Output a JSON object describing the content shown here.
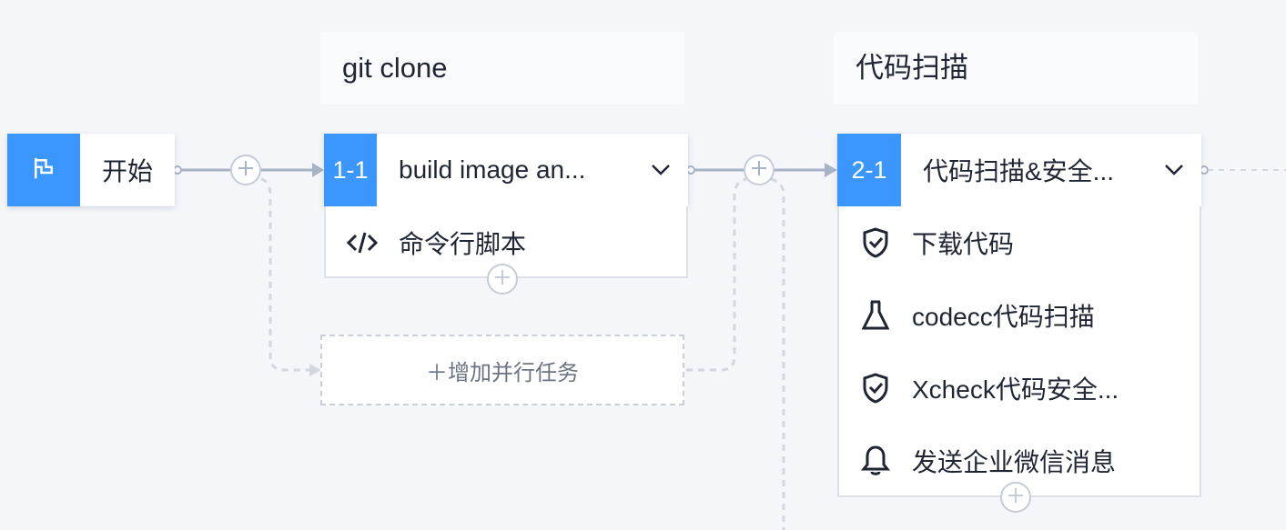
{
  "start": {
    "label": "开始",
    "icon": "flag-icon"
  },
  "stages": [
    {
      "title": "git clone",
      "job": {
        "badge": "1-1",
        "name": "build image an..."
      },
      "tasks": [
        {
          "icon": "code-icon",
          "label": "命令行脚本"
        }
      ]
    },
    {
      "title": "代码扫描",
      "job": {
        "badge": "2-1",
        "name": "代码扫描&安全..."
      },
      "tasks": [
        {
          "icon": "shield-check-icon",
          "label": "下载代码"
        },
        {
          "icon": "flask-icon",
          "label": "codecc代码扫描"
        },
        {
          "icon": "shield-check-icon",
          "label": "Xcheck代码安全..."
        },
        {
          "icon": "bell-icon",
          "label": "发送企业微信消息"
        }
      ]
    }
  ],
  "add_parallel_label": "＋增加并行任务",
  "colors": {
    "accent": "#3c96ff",
    "connector": "#a9b3c6",
    "background": "#f5f6fa"
  }
}
